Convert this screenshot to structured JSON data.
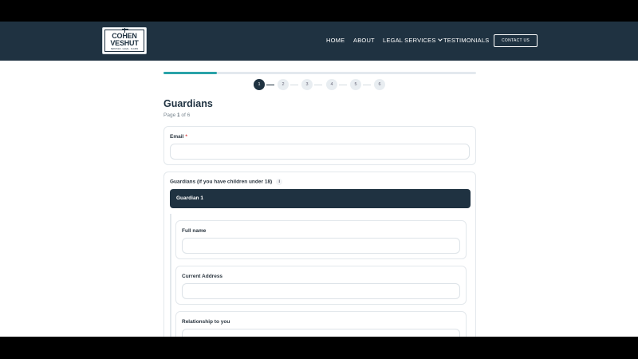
{
  "header": {
    "logo": {
      "line1": "COHEN",
      "line2": "VESHUT",
      "tagline": "SERVICES · LEGAL · CLAIMS"
    },
    "nav": [
      {
        "label": "HOME"
      },
      {
        "label": "ABOUT"
      },
      {
        "label": "LEGAL SERVICES"
      },
      {
        "label": "TESTIMONIALS"
      }
    ],
    "contact_label": "CONTACT US"
  },
  "progress": {
    "fraction": 0.17,
    "color": "#2aa3a8"
  },
  "steps": [
    "1",
    "2",
    "3",
    "4",
    "5",
    "6"
  ],
  "form": {
    "title": "Guardians",
    "page_prefix": "Page ",
    "page_current": "1",
    "page_suffix": " of 6",
    "email": {
      "label": "Email",
      "required_mark": "*",
      "value": ""
    },
    "guardians": {
      "label": "Guardians (if you have children under 18)",
      "info_icon": "i",
      "item_title": "Guardian 1",
      "fields": [
        {
          "label": "Full name",
          "value": ""
        },
        {
          "label": "Current Address",
          "value": ""
        },
        {
          "label": "Relationship to you",
          "value": ""
        }
      ]
    }
  },
  "colors": {
    "brand": "#1f3241",
    "accent": "#2aa3a8",
    "required": "#d84040"
  }
}
